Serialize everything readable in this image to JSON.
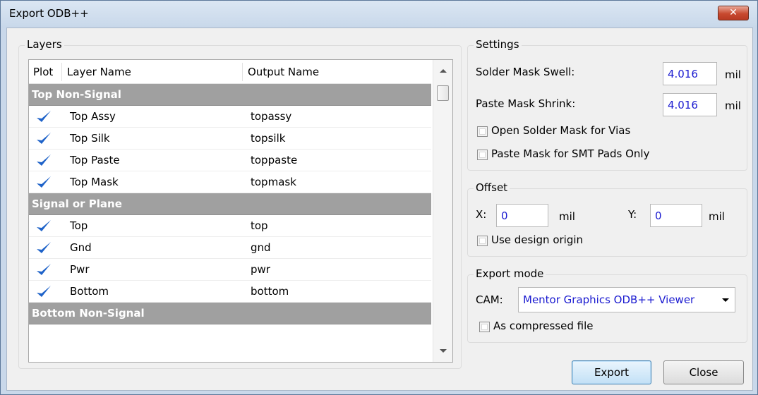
{
  "window": {
    "title": "Export ODB++",
    "close_glyph": "✕"
  },
  "layers": {
    "group_label": "Layers",
    "columns": {
      "plot": "Plot",
      "layer_name": "Layer Name",
      "output_name": "Output Name"
    },
    "rows": [
      {
        "type": "group",
        "label": "Top Non-Signal"
      },
      {
        "type": "layer",
        "plot": true,
        "layer": "Top Assy",
        "output": "topassy"
      },
      {
        "type": "layer",
        "plot": true,
        "layer": "Top Silk",
        "output": "topsilk"
      },
      {
        "type": "layer",
        "plot": true,
        "layer": "Top Paste",
        "output": "toppaste"
      },
      {
        "type": "layer",
        "plot": true,
        "layer": "Top Mask",
        "output": "topmask"
      },
      {
        "type": "group",
        "label": "Signal or Plane"
      },
      {
        "type": "layer",
        "plot": true,
        "layer": "Top",
        "output": "top"
      },
      {
        "type": "layer",
        "plot": true,
        "layer": "Gnd",
        "output": "gnd"
      },
      {
        "type": "layer",
        "plot": true,
        "layer": "Pwr",
        "output": "pwr"
      },
      {
        "type": "layer",
        "plot": true,
        "layer": "Bottom",
        "output": "bottom"
      },
      {
        "type": "group",
        "label": "Bottom Non-Signal"
      }
    ]
  },
  "settings": {
    "group_label": "Settings",
    "solder_mask_swell_label": "Solder Mask Swell:",
    "solder_mask_swell_value": "4.016",
    "paste_mask_shrink_label": "Paste Mask Shrink:",
    "paste_mask_shrink_value": "4.016",
    "unit": "mil",
    "open_solder_mask_vias_label": "Open Solder Mask for Vias",
    "open_solder_mask_vias_checked": false,
    "paste_mask_smt_only_label": "Paste Mask for SMT Pads Only",
    "paste_mask_smt_only_checked": false
  },
  "offset": {
    "group_label": "Offset",
    "x_label": "X:",
    "x_value": "0",
    "y_label": "Y:",
    "y_value": "0",
    "unit": "mil",
    "use_design_origin_label": "Use design origin",
    "use_design_origin_checked": false
  },
  "export_mode": {
    "group_label": "Export mode",
    "cam_label": "CAM:",
    "cam_value": "Mentor Graphics ODB++ Viewer",
    "compressed_label": "As compressed file",
    "compressed_checked": false
  },
  "buttons": {
    "export": "Export",
    "close": "Close"
  },
  "colors": {
    "check": "#1f63c9",
    "group_row": "#a0a0a0",
    "input_text": "#1a1ad0"
  }
}
